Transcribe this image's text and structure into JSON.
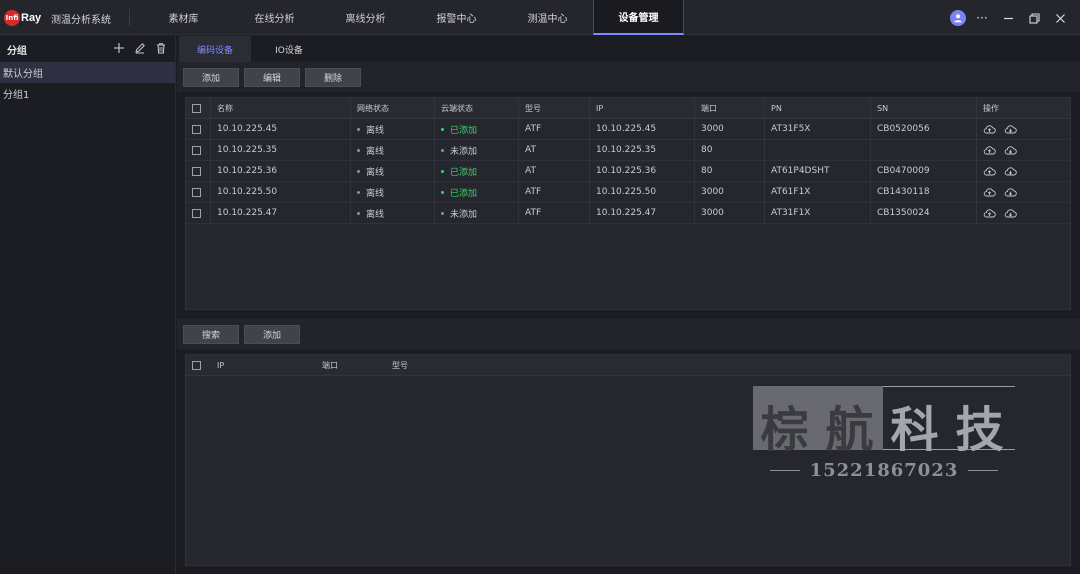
{
  "app": {
    "logo_mark": "Infi",
    "logo_text": "Ray",
    "title": "测温分析系统"
  },
  "nav": {
    "tabs": [
      {
        "label": "素材库"
      },
      {
        "label": "在线分析"
      },
      {
        "label": "离线分析"
      },
      {
        "label": "报警中心"
      },
      {
        "label": "测温中心"
      },
      {
        "label": "设备管理",
        "active": true
      }
    ]
  },
  "window_controls": {
    "more": "···"
  },
  "sidebar": {
    "title": "分组",
    "items": [
      {
        "label": "默认分组",
        "active": true
      },
      {
        "label": "分组1"
      }
    ]
  },
  "subtabs": [
    {
      "label": "编码设备",
      "active": true
    },
    {
      "label": "IO设备"
    }
  ],
  "device_toolbar": {
    "add": "添加",
    "edit": "编辑",
    "delete": "删除"
  },
  "device_table": {
    "headers": [
      "名称",
      "网络状态",
      "云端状态",
      "型号",
      "IP",
      "端口",
      "PN",
      "SN",
      "操作"
    ],
    "rows": [
      {
        "name": "10.10.225.45",
        "net": "离线",
        "cloud": "已添加",
        "cloud_added": true,
        "model": "ATF",
        "ip": "10.10.225.45",
        "port": "3000",
        "pn": "AT31F5X",
        "sn": "CB0520056"
      },
      {
        "name": "10.10.225.35",
        "net": "离线",
        "cloud": "未添加",
        "cloud_added": false,
        "model": "AT",
        "ip": "10.10.225.35",
        "port": "80",
        "pn": "",
        "sn": ""
      },
      {
        "name": "10.10.225.36",
        "net": "离线",
        "cloud": "已添加",
        "cloud_added": true,
        "model": "AT",
        "ip": "10.10.225.36",
        "port": "80",
        "pn": "AT61P4DSHT",
        "sn": "CB0470009"
      },
      {
        "name": "10.10.225.50",
        "net": "离线",
        "cloud": "已添加",
        "cloud_added": true,
        "model": "ATF",
        "ip": "10.10.225.50",
        "port": "3000",
        "pn": "AT61F1X",
        "sn": "CB1430118"
      },
      {
        "name": "10.10.225.47",
        "net": "离线",
        "cloud": "未添加",
        "cloud_added": false,
        "model": "ATF",
        "ip": "10.10.225.47",
        "port": "3000",
        "pn": "AT31F1X",
        "sn": "CB1350024"
      }
    ]
  },
  "search_toolbar": {
    "search": "搜索",
    "add": "添加"
  },
  "search_table": {
    "headers": [
      "IP",
      "端口",
      "型号"
    ]
  },
  "watermark": {
    "chars": [
      "棕",
      "航",
      "科",
      "技"
    ],
    "phone": "15221867023"
  },
  "colors": {
    "accent": "#7b8cff",
    "online_green": "#38d46a",
    "logo_red": "#d42a2a"
  }
}
